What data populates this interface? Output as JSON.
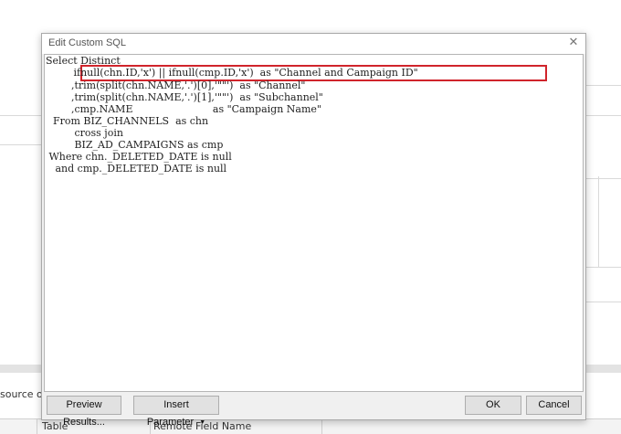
{
  "background": {
    "partial_text": "source or",
    "table_columns": [
      "Table",
      "Remote Field Name"
    ]
  },
  "dialog": {
    "title": "Edit Custom SQL",
    "close_glyph": "✕",
    "sql_lines": [
      "Select Distinct",
      "     ifnull(chn.ID,'x') || ifnull(cmp.ID,'x')  as \"Channel and Campaign ID\"",
      "      ,trim(split(chn.NAME,'.')[0],'\"\"')  as \"Channel\"",
      "      ,trim(split(chn.NAME,'.')[1],'\"\"')  as \"Subchannel\"",
      "      ,cmp.NAME                         as \"Campaign Name\"",
      "  From BIZ_CHANNELS  as chn",
      "       cross join",
      "       BIZ_AD_CAMPAIGNS as cmp",
      " Where chn._DELETED_DATE is null",
      "   and cmp._DELETED_DATE is null"
    ],
    "buttons": {
      "preview": "Preview Results...",
      "insert_parameter": "Insert Parameter",
      "ok": "OK",
      "cancel": "Cancel"
    }
  },
  "colors": {
    "highlight": "#d0242b",
    "dialog_bg": "#f0f0f0"
  }
}
